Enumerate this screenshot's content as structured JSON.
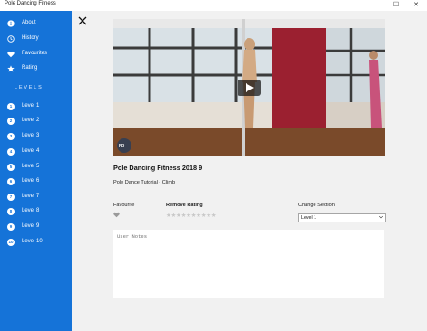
{
  "window": {
    "title": "Pole Dancing Fitness",
    "minimize_glyph": "—",
    "maximize_glyph": "☐",
    "close_glyph": "✕"
  },
  "sidebar": {
    "items": [
      {
        "label": "About",
        "icon": "info-icon"
      },
      {
        "label": "History",
        "icon": "clock-icon"
      },
      {
        "label": "Favourites",
        "icon": "heart-icon"
      },
      {
        "label": "Rating",
        "icon": "star-icon"
      }
    ],
    "levels_header": "LEVELS",
    "levels": [
      {
        "num": "1",
        "label": "Level 1"
      },
      {
        "num": "2",
        "label": "Level 2"
      },
      {
        "num": "3",
        "label": "Level 3"
      },
      {
        "num": "4",
        "label": "Level 4"
      },
      {
        "num": "5",
        "label": "Level 5"
      },
      {
        "num": "6",
        "label": "Level 6"
      },
      {
        "num": "7",
        "label": "Level 7"
      },
      {
        "num": "8",
        "label": "Level 8"
      },
      {
        "num": "9",
        "label": "Level 9"
      },
      {
        "num": "10",
        "label": "Level 10"
      }
    ]
  },
  "video": {
    "title": "Pole Dancing Fitness 2018 9",
    "subtitle": "Pole Dance Tutorial - Climb",
    "badge": "PD"
  },
  "controls": {
    "favourite_label": "Favourite",
    "remove_rating_label": "Remove Rating",
    "rating_stars": "★★★★★★★★★★",
    "change_section_label": "Change Section",
    "section_value": "Level 1"
  },
  "notes": {
    "placeholder": "User Notes"
  },
  "colors": {
    "sidebar": "#1573d8",
    "background": "#f1f1f1"
  }
}
